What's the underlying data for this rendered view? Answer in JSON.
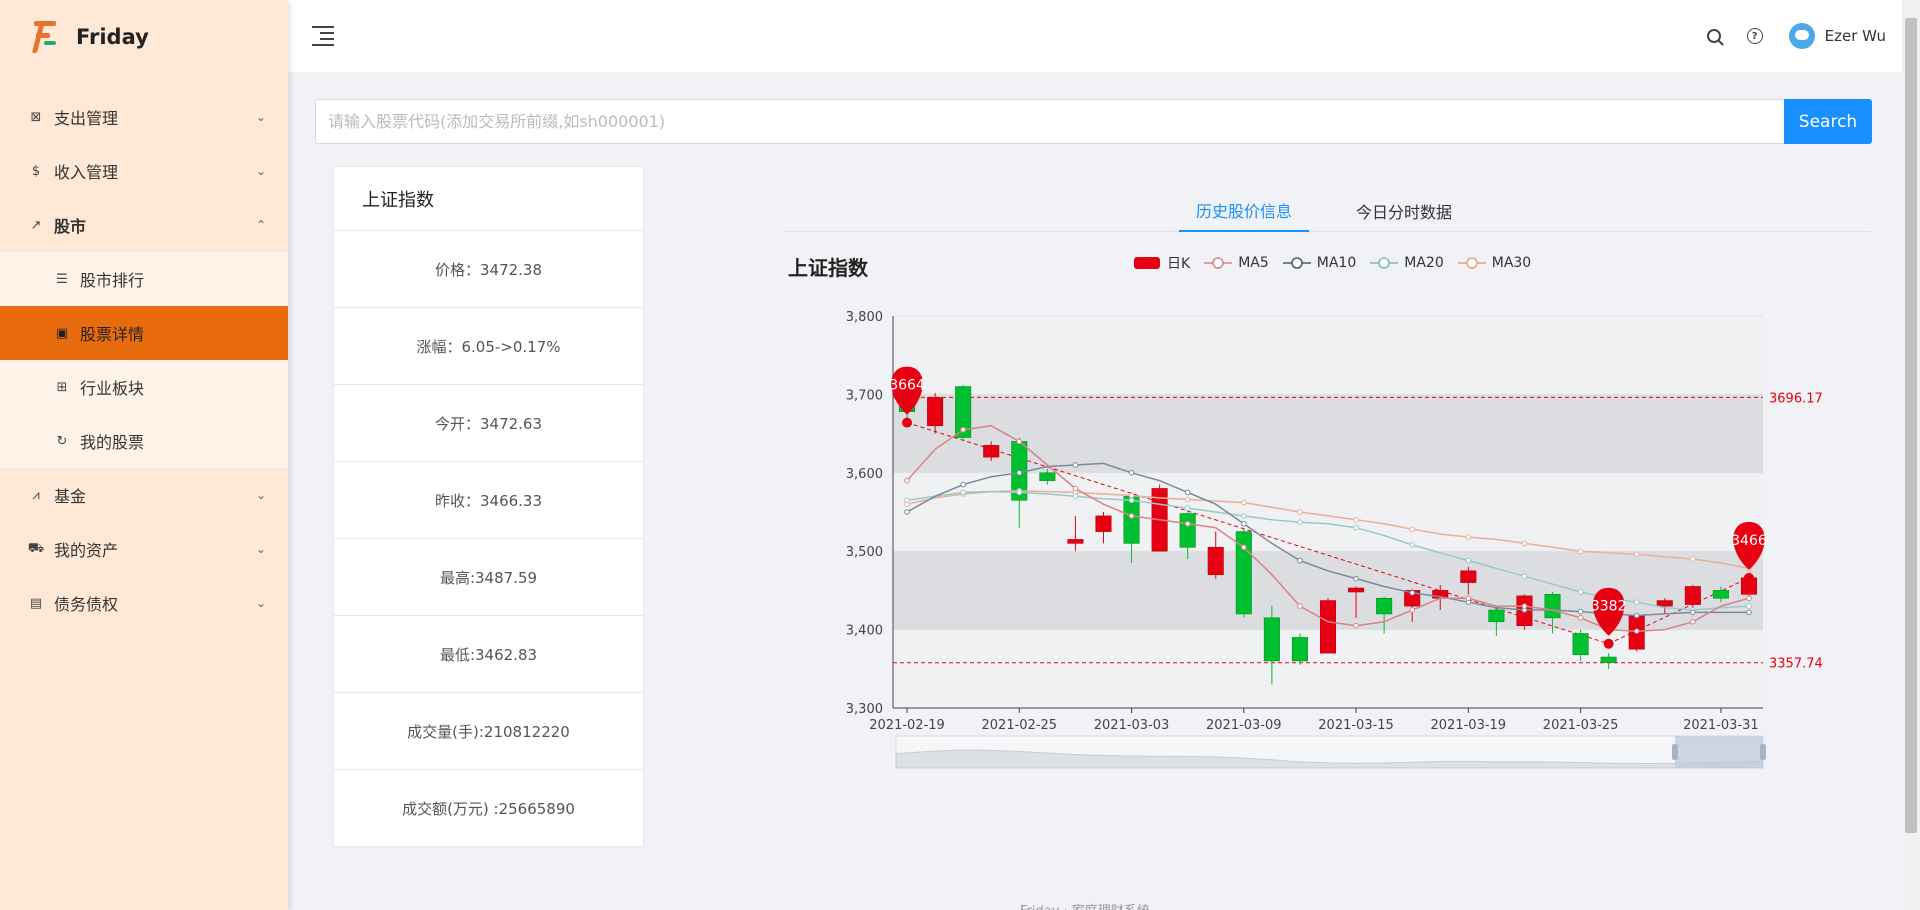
{
  "app": {
    "name": "Friday"
  },
  "sidebar": {
    "items": [
      {
        "label": "支出管理",
        "icon": "receipt-icon"
      },
      {
        "label": "收入管理",
        "icon": "dollar-icon"
      },
      {
        "label": "股市",
        "icon": "line-chart-icon"
      },
      {
        "label": "基金",
        "icon": "area-chart-icon"
      },
      {
        "label": "我的资产",
        "icon": "car-icon"
      },
      {
        "label": "债务债权",
        "icon": "document-icon"
      }
    ],
    "stock_sub": [
      {
        "label": "股市排行",
        "icon": "list-icon"
      },
      {
        "label": "股票详情",
        "icon": "detail-icon"
      },
      {
        "label": "行业板块",
        "icon": "grid-icon"
      },
      {
        "label": "我的股票",
        "icon": "refresh-icon"
      }
    ]
  },
  "header": {
    "user_name": "Ezer Wu"
  },
  "search": {
    "placeholder": "请输入股票代码(添加交易所前缀,如sh000001)",
    "value": "",
    "button_label": "Search"
  },
  "info": {
    "title": "上证指数",
    "rows": [
      "价格：3472.38",
      "涨幅：6.05->0.17%",
      "今开：3472.63",
      "昨收：3466.33",
      "最高:3487.59",
      "最低:3462.83",
      "成交量(手):210812220",
      "成交额(万元) :25665890"
    ]
  },
  "tabs": [
    "历史股价信息",
    "今日分时数据"
  ],
  "footer_text": "Friday · 家庭理财系统",
  "chart_data": {
    "type": "candlestick",
    "title": "上证指数",
    "legend": [
      "日K",
      "MA5",
      "MA10",
      "MA20",
      "MA30"
    ],
    "colors": {
      "up": "#e60012",
      "down": "#00c030",
      "ma5": "#d88484",
      "ma10": "#7a8a9a",
      "ma20": "#9cc8c8",
      "ma30": "#e8b09a",
      "accent": "#1890ff"
    },
    "x_tick_labels": [
      "2021-02-19",
      "2021-02-25",
      "2021-03-03",
      "2021-03-09",
      "2021-03-15",
      "2021-03-19",
      "2021-03-25",
      "2021-03-31"
    ],
    "x_tick_index": [
      0,
      4,
      8,
      12,
      16,
      20,
      24,
      29
    ],
    "ylim": [
      3300,
      3800
    ],
    "y_ticks": [
      3300,
      3400,
      3500,
      3600,
      3700,
      3800
    ],
    "y_tick_labels": [
      "3,300",
      "3,400",
      "3,500",
      "3,600",
      "3,700",
      "3,800"
    ],
    "candles": [
      [
        3690,
        3678,
        3700,
        3664
      ],
      [
        3660,
        3696,
        3702,
        3650
      ],
      [
        3710,
        3645,
        3712,
        3640
      ],
      [
        3620,
        3635,
        3640,
        3615
      ],
      [
        3640,
        3565,
        3645,
        3530
      ],
      [
        3600,
        3590,
        3605,
        3585
      ],
      [
        3510,
        3515,
        3545,
        3500
      ],
      [
        3525,
        3545,
        3550,
        3510
      ],
      [
        3570,
        3510,
        3575,
        3485
      ],
      [
        3500,
        3580,
        3585,
        3500
      ],
      [
        3548,
        3505,
        3552,
        3490
      ],
      [
        3470,
        3505,
        3525,
        3465
      ],
      [
        3525,
        3420,
        3528,
        3415
      ],
      [
        3415,
        3360,
        3430,
        3330
      ],
      [
        3390,
        3360,
        3395,
        3355
      ],
      [
        3370,
        3437,
        3440,
        3370
      ],
      [
        3448,
        3453,
        3455,
        3415
      ],
      [
        3440,
        3420,
        3442,
        3395
      ],
      [
        3430,
        3450,
        3452,
        3410
      ],
      [
        3440,
        3450,
        3457,
        3425
      ],
      [
        3460,
        3475,
        3480,
        3445
      ],
      [
        3425,
        3410,
        3430,
        3392
      ],
      [
        3405,
        3443,
        3445,
        3400
      ],
      [
        3445,
        3415,
        3448,
        3395
      ],
      [
        3395,
        3368,
        3400,
        3360
      ],
      [
        3365,
        3358,
        3370,
        3350
      ],
      [
        3375,
        3418,
        3420,
        3372
      ],
      [
        3430,
        3437,
        3440,
        3420
      ],
      [
        3432,
        3455,
        3457,
        3428
      ],
      [
        3450,
        3440,
        3455,
        3435
      ],
      [
        3445,
        3466,
        3468,
        3440
      ]
    ],
    "ma5": [
      3590,
      3630,
      3655,
      3660,
      3640,
      3610,
      3580,
      3560,
      3545,
      3540,
      3535,
      3530,
      3505,
      3470,
      3430,
      3410,
      3405,
      3410,
      3425,
      3440,
      3440,
      3430,
      3430,
      3425,
      3415,
      3400,
      3398,
      3400,
      3410,
      3430,
      3440
    ],
    "ma10": [
      3550,
      3570,
      3585,
      3595,
      3600,
      3608,
      3610,
      3612,
      3600,
      3590,
      3575,
      3560,
      3535,
      3510,
      3488,
      3475,
      3465,
      3455,
      3447,
      3442,
      3435,
      3428,
      3425,
      3425,
      3423,
      3420,
      3418,
      3420,
      3422,
      3422,
      3422
    ],
    "ma20": [
      3565,
      3570,
      3575,
      3576,
      3575,
      3573,
      3570,
      3567,
      3565,
      3560,
      3555,
      3550,
      3545,
      3540,
      3537,
      3535,
      3530,
      3520,
      3508,
      3498,
      3488,
      3478,
      3468,
      3458,
      3448,
      3440,
      3435,
      3428,
      3425,
      3428,
      3430
    ],
    "ma30": [
      3560,
      3568,
      3573,
      3576,
      3577,
      3576,
      3575,
      3573,
      3571,
      3568,
      3566,
      3564,
      3562,
      3556,
      3550,
      3545,
      3540,
      3535,
      3528,
      3522,
      3518,
      3515,
      3510,
      3505,
      3500,
      3498,
      3496,
      3493,
      3490,
      3485,
      3478
    ],
    "mark_lines": [
      3696.17,
      3357.74
    ],
    "mark_line_labels": [
      "3696.17",
      "3357.74"
    ],
    "mark_points": [
      {
        "label": "3664",
        "index": 0,
        "value": 3664
      },
      {
        "label": "3382",
        "index": 25,
        "value": 3382
      },
      {
        "label": "3466",
        "index": 30,
        "value": 3466
      }
    ],
    "mark_areas": [
      [
        3600,
        3700
      ],
      [
        3400,
        3500
      ]
    ],
    "legend_position": "top-center",
    "datazoom": true
  }
}
